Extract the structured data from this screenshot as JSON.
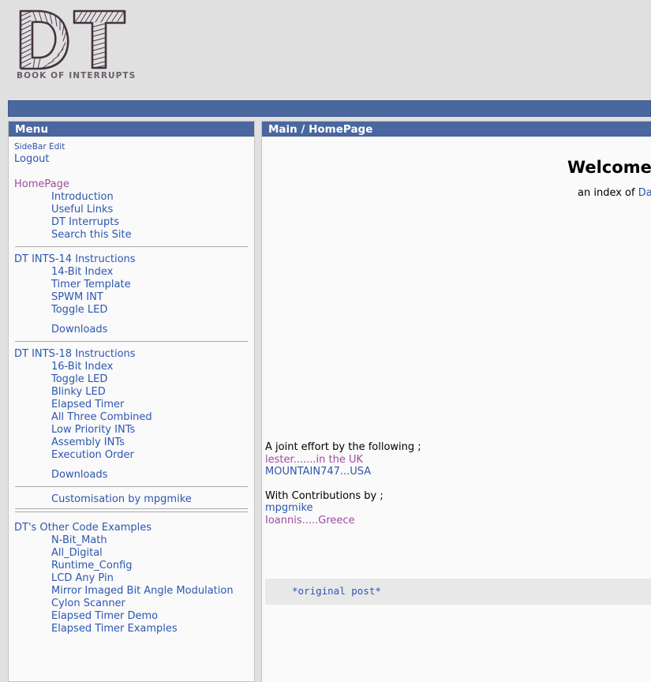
{
  "logo": {
    "mark_text": "DT",
    "subtitle": "BOOK OF INTERRUPTS"
  },
  "top_nav": {
    "label": ""
  },
  "sidebar": {
    "title": "Menu",
    "top_links": [
      {
        "label": "SideBar Edit",
        "visited": false,
        "small": true
      },
      {
        "label": "Logout",
        "visited": false,
        "small": false
      }
    ],
    "groups": [
      {
        "head": {
          "label": "HomePage",
          "visited": true
        },
        "items": [
          {
            "label": "Introduction"
          },
          {
            "label": "Useful Links"
          },
          {
            "label": "DT Interrupts"
          },
          {
            "label": "Search this Site"
          }
        ],
        "extra": []
      },
      {
        "head": {
          "label": "DT INTS-14 Instructions",
          "visited": false
        },
        "items": [
          {
            "label": "14-Bit Index"
          },
          {
            "label": "Timer Template"
          },
          {
            "label": "SPWM INT"
          },
          {
            "label": "Toggle LED"
          }
        ],
        "extra": [
          {
            "label": "Downloads"
          }
        ]
      },
      {
        "head": {
          "label": "DT INTS-18 Instructions",
          "visited": false
        },
        "items": [
          {
            "label": "16-Bit Index"
          },
          {
            "label": "Toggle LED"
          },
          {
            "label": "Blinky LED"
          },
          {
            "label": "Elapsed Timer"
          },
          {
            "label": "All Three Combined"
          },
          {
            "label": "Low Priority INTs"
          },
          {
            "label": "Assembly INTs"
          },
          {
            "label": "Execution Order"
          }
        ],
        "extra": [
          {
            "label": "Downloads"
          }
        ]
      }
    ],
    "customisation": {
      "label": "Customisation by mpgmike"
    },
    "other_examples": {
      "head": {
        "label": "DT's Other Code Examples",
        "visited": false
      },
      "items": [
        {
          "label": "N-Bit_Math"
        },
        {
          "label": "All_Digital"
        },
        {
          "label": "Runtime_Config"
        },
        {
          "label": "LCD Any Pin"
        },
        {
          "label": "Mirror Imaged Bit Angle Modulation"
        },
        {
          "label": "Cylon Scanner"
        },
        {
          "label": "Elapsed Timer Demo"
        },
        {
          "label": "Elapsed Timer Examples"
        }
      ]
    }
  },
  "main": {
    "title": "Main / HomePage",
    "welcome_heading": "Welcome to",
    "welcome_sub_prefix": "an index of ",
    "welcome_sub_link": "Da",
    "credits": {
      "joint_label": "A joint effort by the following ;",
      "joint_people": [
        {
          "label": "lester.......in the UK",
          "visited": true
        },
        {
          "label": "MOUNTAIN747...USA",
          "visited": false
        }
      ],
      "contrib_label": "With Contributions by ;",
      "contrib_people": [
        {
          "label": "mpgmike",
          "visited": false
        },
        {
          "label": "Ioannis.....Greece",
          "visited": true
        }
      ]
    },
    "code_block": {
      "text": "*original post*"
    }
  },
  "colors": {
    "header_blue": "#4a679f",
    "page_background": "#e0e0e0",
    "panel_background": "#fafafa",
    "link": "#2d56b0",
    "link_visited": "#9e4b9e",
    "code_background": "#e8e8e8",
    "logo_ink": "#453340",
    "logo_subtitle": "#6b6069"
  }
}
